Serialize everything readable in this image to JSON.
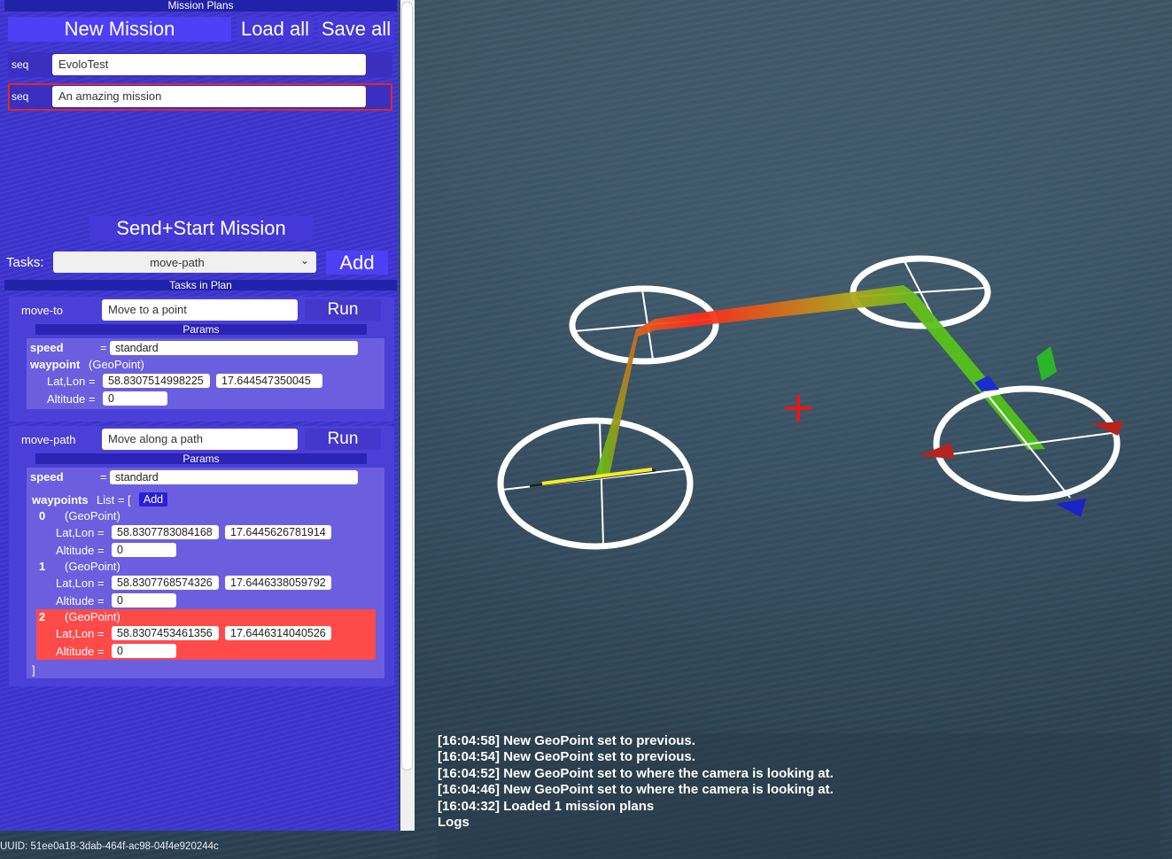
{
  "panel": {
    "header": "Mission Plans",
    "new_mission": "New Mission",
    "load_all": "Load all",
    "save_all": "Save all",
    "plans": [
      {
        "label": "seq",
        "name": "EvoloTest"
      },
      {
        "label": "seq",
        "name": "An amazing mission"
      }
    ],
    "send_start": "Send+Start Mission",
    "tasks_label": "Tasks:",
    "task_select_value": "move-path",
    "add_button": "Add",
    "tasks_in_plan": "Tasks in Plan"
  },
  "tasks": [
    {
      "type": "move-to",
      "description": "Move to a point",
      "run": "Run",
      "params_label": "Params",
      "speed_label": "speed",
      "equals": "=",
      "speed_value": "standard",
      "waypoint_label": "waypoint",
      "waypoint_type": "(GeoPoint)",
      "latlon_label": "Lat,Lon =",
      "lat": "58.8307514998225",
      "lon": "17.644547350045",
      "altitude_label": "Altitude =",
      "altitude": "0"
    },
    {
      "type": "move-path",
      "description": "Move along a path",
      "run": "Run",
      "params_label": "Params",
      "speed_label": "speed",
      "equals": "=",
      "speed_value": "standard",
      "waypoints_label": "waypoints",
      "list_label": "List = [",
      "add_label": "Add",
      "close_bracket": "]",
      "waypoints": [
        {
          "index": "0",
          "type": "(GeoPoint)",
          "latlon_label": "Lat,Lon =",
          "lat": "58.8307783084168",
          "lon": "17.6445626781914",
          "altitude_label": "Altitude =",
          "altitude": "0",
          "selected": false
        },
        {
          "index": "1",
          "type": "(GeoPoint)",
          "latlon_label": "Lat,Lon =",
          "lat": "58.8307768574326",
          "lon": "17.6446338059792",
          "altitude_label": "Altitude =",
          "altitude": "0",
          "selected": false
        },
        {
          "index": "2",
          "type": "(GeoPoint)",
          "latlon_label": "Lat,Lon =",
          "lat": "58.8307453461356",
          "lon": "17.6446314040526",
          "altitude_label": "Altitude =",
          "altitude": "0",
          "selected": true
        }
      ]
    }
  ],
  "uuid": "UUID: 51ee0a18-3dab-464f-ac98-04f4e920244c",
  "logs": {
    "lines": [
      "[16:04:58] New GeoPoint set to previous.",
      "[16:04:54] New GeoPoint set to previous.",
      "[16:04:52] New GeoPoint set to where the camera is looking at.",
      "[16:04:46] New GeoPoint set to where the camera is looking at.",
      "[16:04:32] Loaded 1 mission plans"
    ],
    "title": "Logs"
  },
  "colors": {
    "panel_bg": "#3e36d2",
    "button_blue": "#4d3ff5",
    "selected_red": "#ff4a4a",
    "path_start": "#ff2a1a",
    "path_end": "#4fc21a",
    "water": "#324a5c"
  }
}
